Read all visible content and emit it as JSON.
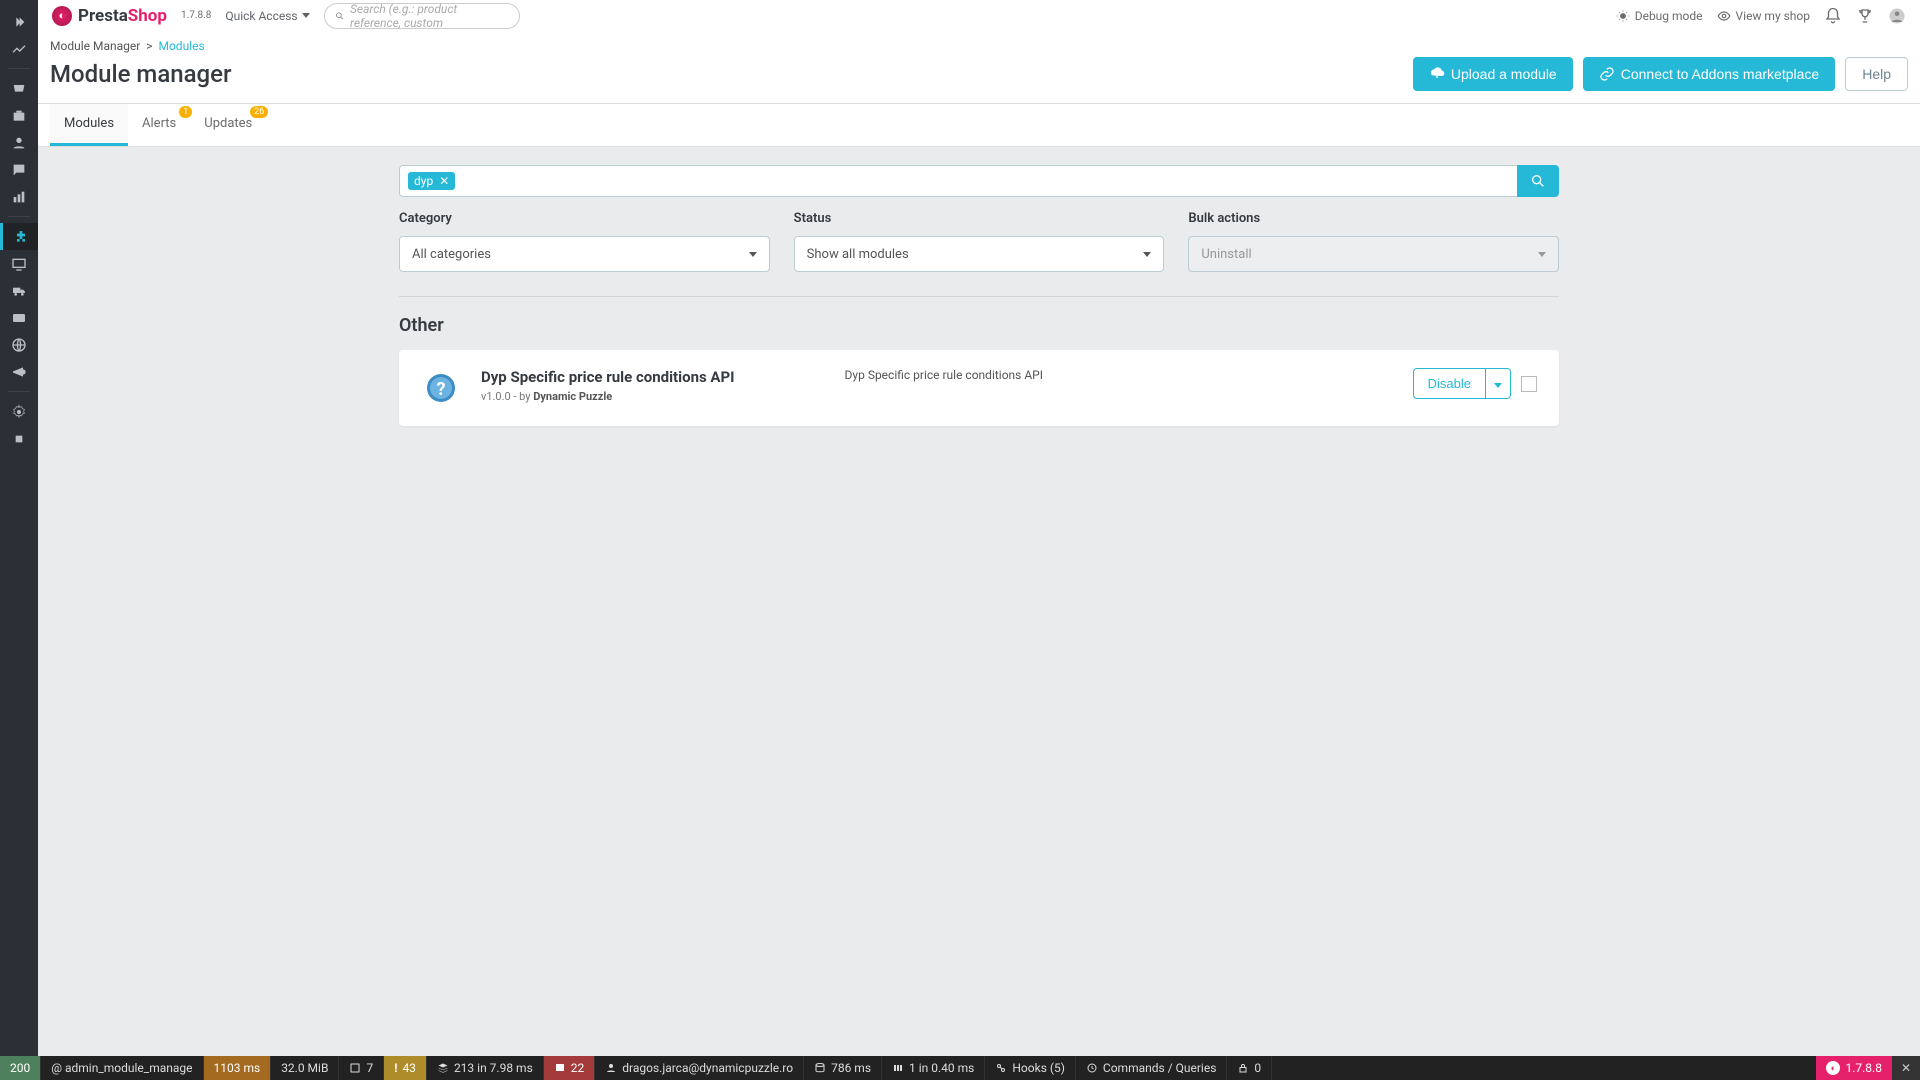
{
  "header": {
    "brand_a": "Presta",
    "brand_b": "Shop",
    "version": "1.7.8.8",
    "quick_access": "Quick Access",
    "search_placeholder": "Search (e.g.: product reference, custom",
    "debug_mode": "Debug mode",
    "view_shop": "View my shop"
  },
  "breadcrumb": {
    "root": "Module Manager",
    "leaf": "Modules"
  },
  "page_title": "Module manager",
  "buttons": {
    "upload": "Upload a module",
    "connect": "Connect to Addons marketplace",
    "help": "Help"
  },
  "tabs": [
    {
      "label": "Modules",
      "badge": ""
    },
    {
      "label": "Alerts",
      "badge": "1"
    },
    {
      "label": "Updates",
      "badge": "26"
    }
  ],
  "search_tag": "dyp",
  "filters": {
    "category_label": "Category",
    "category_value": "All categories",
    "status_label": "Status",
    "status_value": "Show all modules",
    "bulk_label": "Bulk actions",
    "bulk_value": "Uninstall"
  },
  "section": "Other",
  "module": {
    "title": "Dyp Specific price rule conditions API",
    "version_prefix": "v1.0.0 - by ",
    "author": "Dynamic Puzzle",
    "description": "Dyp Specific price rule conditions API",
    "action": "Disable"
  },
  "debug": {
    "status": "200",
    "route": "@ admin_module_manage",
    "time": "1103 ms",
    "mem": "32.0 MiB",
    "ajax_n": "7",
    "warn_n": "43",
    "stack": "213 in 7.98 ms",
    "forms_n": "22",
    "user": "dragos.jarca@dynamicpuzzle.ro",
    "db": "786 ms",
    "cache": "1 in 0.40 ms",
    "hooks": "Hooks (5)",
    "cmd": "Commands / Queries",
    "lock": "0",
    "ver": "1.7.8.8"
  }
}
